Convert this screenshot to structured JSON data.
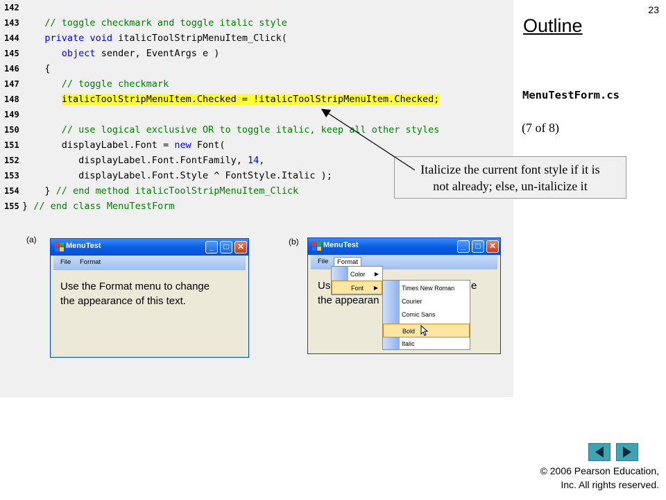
{
  "slide_number": "23",
  "outline_title": "Outline",
  "file_name": "MenuTestForm.cs",
  "part_label": "(7 of 8)",
  "callout_text_line1": "Italicize the current font style if it is",
  "callout_text_line2": "not already; else, un-italicize it",
  "code_lines": [
    {
      "num": "142",
      "segments": [
        {
          "t": "",
          "c": ""
        }
      ]
    },
    {
      "num": "143",
      "segments": [
        {
          "t": "   // toggle checkmark and toggle italic style",
          "c": "cm"
        }
      ]
    },
    {
      "num": "144",
      "segments": [
        {
          "t": "   ",
          "c": ""
        },
        {
          "t": "private",
          "c": "kw"
        },
        {
          "t": " ",
          "c": ""
        },
        {
          "t": "void",
          "c": "kw"
        },
        {
          "t": " italicToolStripMenuItem_Click(",
          "c": ""
        }
      ]
    },
    {
      "num": "145",
      "segments": [
        {
          "t": "      ",
          "c": ""
        },
        {
          "t": "object",
          "c": "kw"
        },
        {
          "t": " sender, EventArgs e )",
          "c": ""
        }
      ]
    },
    {
      "num": "146",
      "segments": [
        {
          "t": "   {",
          "c": ""
        }
      ]
    },
    {
      "num": "147",
      "segments": [
        {
          "t": "      // toggle checkmark",
          "c": "cm"
        }
      ]
    },
    {
      "num": "148",
      "segments": [
        {
          "t": "      ",
          "c": ""
        },
        {
          "t": "italicToolStripMenuItem.Checked = !italicToolStripMenuItem.Checked;",
          "c": "hl"
        }
      ]
    },
    {
      "num": "149",
      "segments": [
        {
          "t": "",
          "c": ""
        }
      ]
    },
    {
      "num": "150",
      "segments": [
        {
          "t": "      // use logical exclusive OR to toggle italic, keep all other styles",
          "c": "cm"
        }
      ]
    },
    {
      "num": "151",
      "segments": [
        {
          "t": "      displayLabel.Font = ",
          "c": ""
        },
        {
          "t": "new",
          "c": "kw"
        },
        {
          "t": " Font(",
          "c": ""
        }
      ]
    },
    {
      "num": "152",
      "segments": [
        {
          "t": "         displayLabel.Font.FontFamily, ",
          "c": ""
        },
        {
          "t": "14",
          "c": "num"
        },
        {
          "t": ",",
          "c": ""
        }
      ]
    },
    {
      "num": "153",
      "segments": [
        {
          "t": "         displayLabel.Font.Style ^ FontStyle.Italic );",
          "c": ""
        }
      ]
    },
    {
      "num": "154",
      "segments": [
        {
          "t": "   } ",
          "c": ""
        },
        {
          "t": "// end method italicToolStripMenuItem_Click",
          "c": "cm"
        }
      ]
    },
    {
      "num": "155",
      "segments": [
        {
          "t": "} ",
          "c": ""
        },
        {
          "t": "// end class MenuTestForm",
          "c": "cm"
        }
      ]
    }
  ],
  "figure_a_label": "(a)",
  "figure_b_label": "(b)",
  "window_a": {
    "title": "MenuTest",
    "menu": [
      "File",
      "Format"
    ],
    "text_line1": "Use the Format menu to change",
    "text_line2": "the appearance of this text."
  },
  "window_b": {
    "title": "MenuTest",
    "menu": [
      "File",
      "Format"
    ],
    "text_line1_visible": "Us",
    "text_line1_tail": "e",
    "text_line2_visible": "the appearan",
    "format_menu": [
      {
        "label": "Color",
        "submenu": true
      },
      {
        "label": "Font",
        "submenu": true,
        "selected": true
      }
    ],
    "font_menu": [
      {
        "label": "Times New Roman"
      },
      {
        "label": "Courier"
      },
      {
        "label": "Comic Sans"
      },
      {
        "label": "Bold",
        "selected": true
      },
      {
        "label": "Italic"
      }
    ]
  },
  "copyright_line1": "© 2006 Pearson Education,",
  "copyright_line2": "Inc.  All rights reserved.",
  "icons": [
    "app-icon",
    "minimize-icon",
    "maximize-icon",
    "close-icon",
    "chevron-right-icon",
    "cursor-icon",
    "nav-back-icon",
    "nav-forward-icon"
  ],
  "colors": {
    "highlight": "#ffff33",
    "keyword": "#0000ff",
    "comment": "#008000",
    "nav_button": "#3fa3b4"
  }
}
